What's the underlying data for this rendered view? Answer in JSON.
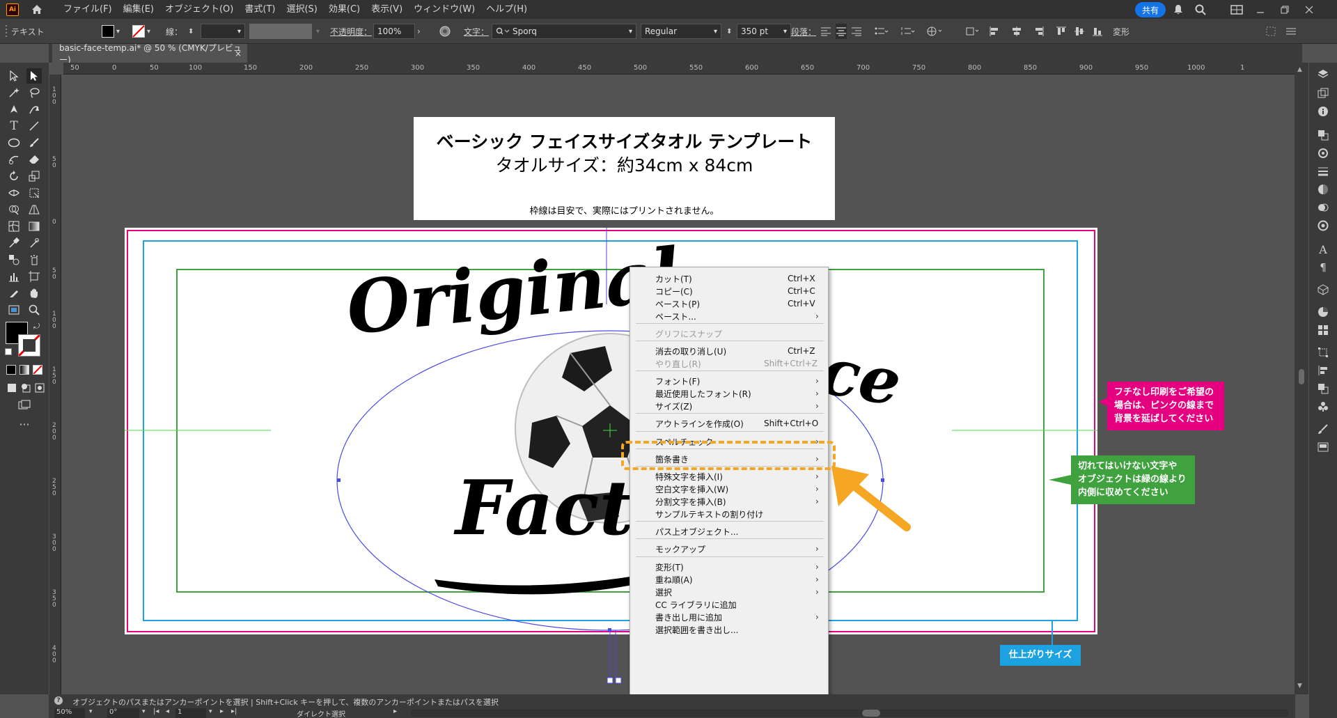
{
  "app": {
    "logo_text": "Ai",
    "menus": [
      "ファイル(F)",
      "編集(E)",
      "オブジェクト(O)",
      "書式(T)",
      "選択(S)",
      "効果(C)",
      "表示(V)",
      "ウィンドウ(W)",
      "ヘルプ(H)"
    ],
    "share_label": "共有"
  },
  "control_bar": {
    "mode_label": "テキスト",
    "stroke_label": "線：",
    "opacity_label": "不透明度：",
    "opacity_value": "100%",
    "text_label": "文字：",
    "font_name": "Sporq",
    "font_style": "Regular",
    "font_size": "350 pt",
    "paragraph_label": "段落：",
    "transform_label": "変形"
  },
  "document": {
    "tab_title": "basic-face-temp.ai* @ 50 % (CMYK/プレビュー)",
    "close_symbol": "×"
  },
  "ruler": {
    "h_ticks": [
      "50",
      "0",
      "50",
      "100",
      "150",
      "200",
      "250",
      "300",
      "350",
      "400",
      "450",
      "500",
      "550",
      "600",
      "650",
      "700",
      "750",
      "800",
      "850",
      "900",
      "950",
      "1000",
      "1"
    ],
    "v_ticks": [
      "100",
      "50",
      "0",
      "50",
      "100",
      "150",
      "200",
      "250",
      "300",
      "350",
      "400"
    ]
  },
  "header_board": {
    "title": "ベーシック フェイスサイズタオル テンプレート",
    "size_line": "タオルサイズ：約34cm x 84cm",
    "note": "枠線は目安で、実際にはプリントされません。"
  },
  "design": {
    "line1": "Original",
    "line1_right": "ce",
    "line2": "Fact"
  },
  "callouts": {
    "pink": [
      "フチなし印刷をご希望の",
      "場合は、ピンクの線まで",
      "背景を延ばしてください"
    ],
    "green": [
      "切れてはいけない文字や",
      "オブジェクトは緑の線より",
      "内側に収めてください"
    ],
    "blue": "仕上がりサイズ"
  },
  "context_menu": {
    "items": [
      {
        "label": "カット(T)",
        "shortcut": "Ctrl+X",
        "disabled": false,
        "submenu": false
      },
      {
        "label": "コピー(C)",
        "shortcut": "Ctrl+C",
        "disabled": false,
        "submenu": false
      },
      {
        "label": "ペースト(P)",
        "shortcut": "Ctrl+V",
        "disabled": false,
        "submenu": false
      },
      {
        "label": "ペースト...",
        "shortcut": "",
        "disabled": false,
        "submenu": true
      },
      {
        "label": "グリフにスナップ",
        "shortcut": "",
        "disabled": true,
        "submenu": false
      },
      {
        "label": "消去の取り消し(U)",
        "shortcut": "Ctrl+Z",
        "disabled": false,
        "submenu": false
      },
      {
        "label": "やり直し(R)",
        "shortcut": "Shift+Ctrl+Z",
        "disabled": true,
        "submenu": false
      },
      {
        "label": "フォント(F)",
        "shortcut": "",
        "disabled": false,
        "submenu": true
      },
      {
        "label": "最近使用したフォント(R)",
        "shortcut": "",
        "disabled": false,
        "submenu": true
      },
      {
        "label": "サイズ(Z)",
        "shortcut": "",
        "disabled": false,
        "submenu": true
      },
      {
        "label": "アウトラインを作成(O)",
        "shortcut": "Shift+Ctrl+O",
        "disabled": false,
        "submenu": false
      },
      {
        "label": "スペルチェック",
        "shortcut": "",
        "disabled": false,
        "submenu": true
      },
      {
        "label": "箇条書き",
        "shortcut": "",
        "disabled": false,
        "submenu": true
      },
      {
        "label": "特殊文字を挿入(I)",
        "shortcut": "",
        "disabled": false,
        "submenu": true
      },
      {
        "label": "空白文字を挿入(W)",
        "shortcut": "",
        "disabled": false,
        "submenu": true
      },
      {
        "label": "分割文字を挿入(B)",
        "shortcut": "",
        "disabled": false,
        "submenu": true
      },
      {
        "label": "サンプルテキストの割り付け",
        "shortcut": "",
        "disabled": false,
        "submenu": false
      },
      {
        "label": "パス上オブジェクト...",
        "shortcut": "",
        "disabled": false,
        "submenu": false
      },
      {
        "label": "モックアップ",
        "shortcut": "",
        "disabled": false,
        "submenu": true
      },
      {
        "label": "変形(T)",
        "shortcut": "",
        "disabled": false,
        "submenu": true
      },
      {
        "label": "重ね順(A)",
        "shortcut": "",
        "disabled": false,
        "submenu": true
      },
      {
        "label": "選択",
        "shortcut": "",
        "disabled": false,
        "submenu": true
      },
      {
        "label": "CC ライブラリに追加",
        "shortcut": "",
        "disabled": false,
        "submenu": false
      },
      {
        "label": "書き出し用に追加",
        "shortcut": "",
        "disabled": false,
        "submenu": true
      },
      {
        "label": "選択範囲を書き出し...",
        "shortcut": "",
        "disabled": false,
        "submenu": false
      }
    ],
    "submenu_arrow": "›"
  },
  "status": {
    "hint": "オブジェクトのパスまたはアンカーポイントを選択 | Shift+Click キーを押して、複数のアンカーポイントまたはパスを選択",
    "zoom": "50%",
    "rotation": "0°",
    "artboard_index": "1",
    "tool_name": "ダイレクト選択"
  },
  "colors": {
    "accent": "#1473e6",
    "pink_guide": "#e4007f",
    "blue_guide": "#1ca2e0",
    "green_guide": "#3fa23f",
    "highlight": "#f5a623"
  }
}
